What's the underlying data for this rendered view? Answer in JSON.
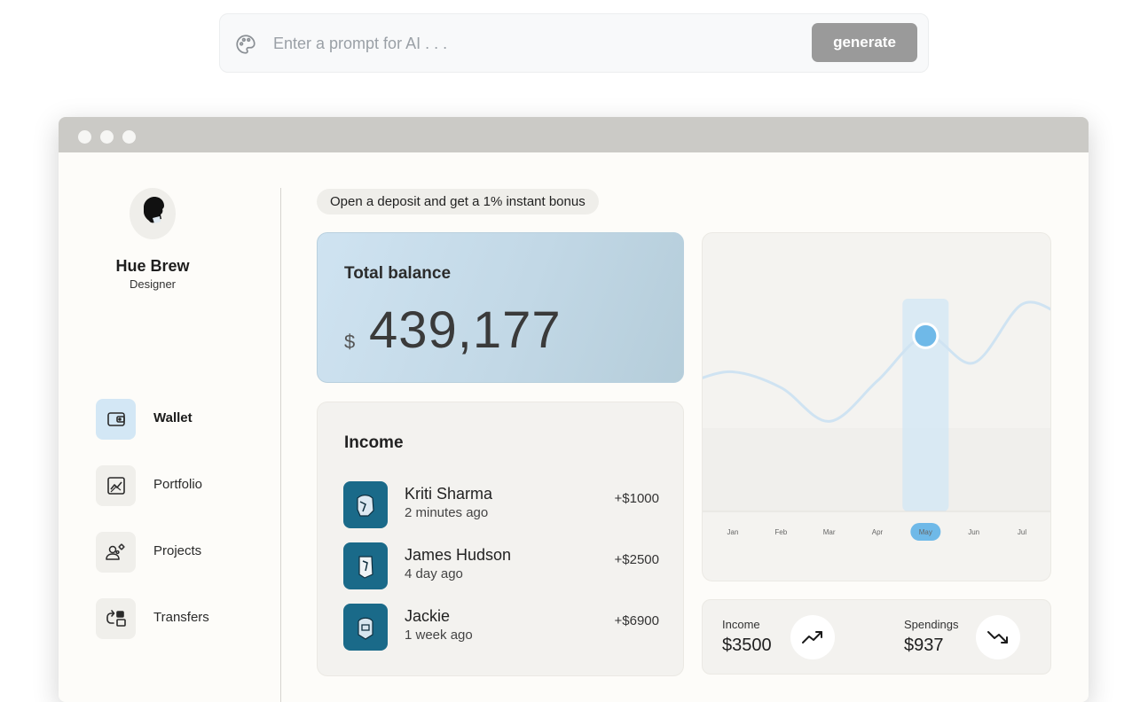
{
  "prompt": {
    "icon": "palette-icon",
    "placeholder": "Enter a prompt for AI . . .",
    "value": "",
    "button_label": "generate"
  },
  "window": {
    "controls": [
      "window-dot",
      "window-dot",
      "window-dot"
    ]
  },
  "profile": {
    "name": "Hue Brew",
    "role": "Designer"
  },
  "nav": {
    "items": [
      {
        "label": "Wallet",
        "icon": "wallet-icon",
        "active": true
      },
      {
        "label": "Portfolio",
        "icon": "chart-icon",
        "active": false
      },
      {
        "label": "Projects",
        "icon": "user-gear-icon",
        "active": false
      },
      {
        "label": "Transfers",
        "icon": "transfer-icon",
        "active": false
      }
    ]
  },
  "promo": "Open a deposit and get a 1% instant bonus",
  "balance": {
    "title": "Total balance",
    "currency": "$",
    "amount": "439,177"
  },
  "income": {
    "title": "Income",
    "transactions": [
      {
        "name": "Kriti Sharma",
        "time": "2 minutes ago",
        "amount": "+$1000"
      },
      {
        "name": "James Hudson",
        "time": "4 day ago",
        "amount": "+$2500"
      },
      {
        "name": "Jackie",
        "time": "1 week ago",
        "amount": "+$6900"
      }
    ]
  },
  "chart_data": {
    "type": "line",
    "categories": [
      "Jan",
      "Feb",
      "Mar",
      "Apr",
      "May",
      "Jun",
      "Jul"
    ],
    "values": [
      0.62,
      0.55,
      0.4,
      0.58,
      0.78,
      0.66,
      0.92
    ],
    "selected": "May",
    "title": "",
    "xlabel": "",
    "ylabel": "",
    "grid": false,
    "colors": {
      "line": "#cfe3f2",
      "highlight_band": "#d5e8f4",
      "marker": "#6fb9e8",
      "selected_pill": "#6fb9e8"
    }
  },
  "stats": {
    "income": {
      "label": "Income",
      "value": "$3500",
      "icon": "trend-up-icon"
    },
    "spendings": {
      "label": "Spendings",
      "value": "$937",
      "icon": "trend-down-icon"
    }
  },
  "colors": {
    "accent": "#6fb9e8",
    "avatar_bg": "#1a6a89",
    "generate_button": "#9a9a9a"
  }
}
